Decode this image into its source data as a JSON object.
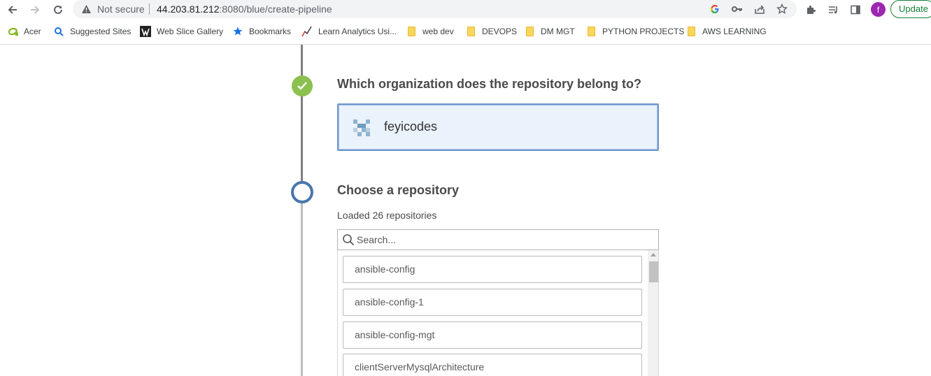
{
  "browser": {
    "security_label": "Not secure",
    "url_host": "44.203.81.212",
    "url_path": ":8080/blue/create-pipeline",
    "update_label": "Update",
    "profile_initial": "f"
  },
  "bookmarks": [
    {
      "label": "Acer",
      "icon": "acer-icon"
    },
    {
      "label": "Suggested Sites",
      "icon": "search-icon"
    },
    {
      "label": "Web Slice Gallery",
      "icon": "web-slice-icon"
    },
    {
      "label": "Bookmarks",
      "icon": "star-icon"
    },
    {
      "label": "Learn Analytics Usi...",
      "icon": "analytics-icon"
    },
    {
      "label": "web dev",
      "icon": "folder-icon"
    },
    {
      "label": "DEVOPS",
      "icon": "folder-icon"
    },
    {
      "label": "DM MGT",
      "icon": "folder-icon"
    },
    {
      "label": "PYTHON PROJECTS",
      "icon": "folder-icon"
    },
    {
      "label": "AWS LEARNING",
      "icon": "folder-icon"
    }
  ],
  "steps": {
    "organization": {
      "title": "Which organization does the repository belong to?",
      "selected_org": "feyicodes"
    },
    "repository": {
      "title": "Choose a repository",
      "loaded_text": "Loaded 26 repositories",
      "search_placeholder": "Search...",
      "repositories": [
        "ansible-config",
        "ansible-config-1",
        "ansible-config-mgt",
        "clientServerMysqlArchitecture"
      ]
    }
  },
  "colors": {
    "step_done": "#8cc04f",
    "step_current": "#4a75ad",
    "selected_border": "#6c97cc",
    "selected_bg": "#eaf2fb",
    "update_green": "#188038"
  }
}
